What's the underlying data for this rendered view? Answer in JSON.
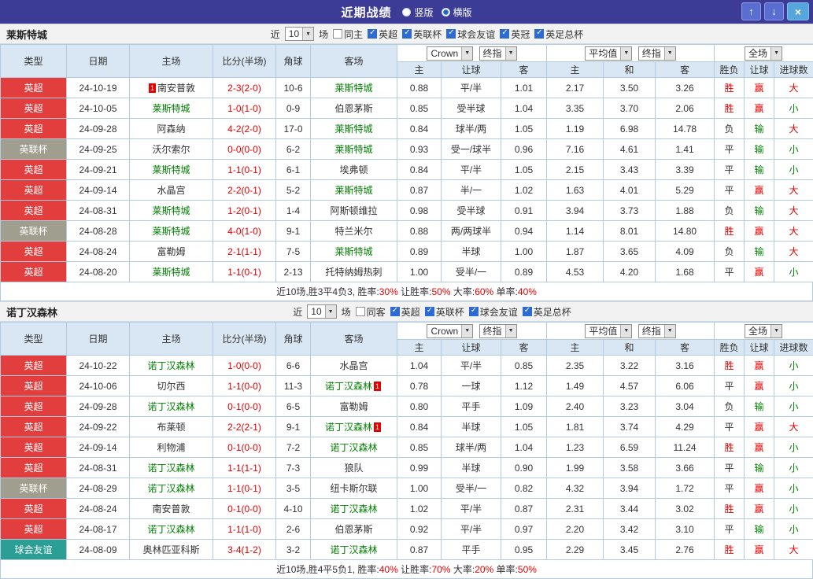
{
  "titlebar": {
    "title": "近期战绩",
    "radios": [
      {
        "label": "竖版",
        "selected": false
      },
      {
        "label": "横版",
        "selected": true
      }
    ],
    "up_icon": "↑",
    "down_icon": "↓",
    "close_icon": "×"
  },
  "filter": {
    "near": "近",
    "count": "10",
    "unit": "场"
  },
  "table_header": {
    "type": "类型",
    "date": "日期",
    "home": "主场",
    "score": "比分(半场)",
    "corner": "角球",
    "away": "客场",
    "bookmaker_select": "Crown",
    "final_select": "终指",
    "avg_select": "平均值",
    "scope_select": "全场",
    "ah_home": "主",
    "ah_line": "让球",
    "ah_away": "客",
    "eu_home": "主",
    "eu_draw": "和",
    "eu_away": "客",
    "result": "胜负",
    "asian": "让球",
    "goals": "进球数"
  },
  "colors": {
    "league": {
      "英超": "#e23e3e",
      "英联杯": "#a09e8e",
      "球会友谊": "#2b9e96"
    },
    "text": {
      "red": "#e60000",
      "green": "#008000",
      "black": "#333333"
    },
    "team_green": "#008000"
  },
  "sections": [
    {
      "team": "莱斯特城",
      "same_label": "同主",
      "same_checked": false,
      "leagues": [
        {
          "label": "英超",
          "checked": true
        },
        {
          "label": "英联杯",
          "checked": true
        },
        {
          "label": "球会友谊",
          "checked": true
        },
        {
          "label": "英冠",
          "checked": true
        },
        {
          "label": "英足总杯",
          "checked": true
        }
      ],
      "rows": [
        {
          "league": "英超",
          "date": "24-10-19",
          "home": {
            "name": "南安普敦",
            "green": false,
            "badge": "1",
            "badge_side": "left"
          },
          "score": "2-3(2-0)",
          "corner": "10-6",
          "away": {
            "name": "莱斯特城",
            "green": true
          },
          "ah": [
            "0.88",
            "平/半",
            "1.01"
          ],
          "eu": [
            "2.17",
            "3.50",
            "3.26"
          ],
          "result": {
            "t": "胜",
            "c": "red"
          },
          "asian": {
            "t": "赢",
            "c": "red"
          },
          "goals": {
            "t": "大",
            "c": "red"
          }
        },
        {
          "league": "英超",
          "date": "24-10-05",
          "home": {
            "name": "莱斯特城",
            "green": true
          },
          "score": "1-0(1-0)",
          "corner": "0-9",
          "away": {
            "name": "伯恩茅斯",
            "green": false
          },
          "ah": [
            "0.85",
            "受半球",
            "1.04"
          ],
          "eu": [
            "3.35",
            "3.70",
            "2.06"
          ],
          "result": {
            "t": "胜",
            "c": "red"
          },
          "asian": {
            "t": "赢",
            "c": "red"
          },
          "goals": {
            "t": "小",
            "c": "green"
          }
        },
        {
          "league": "英超",
          "date": "24-09-28",
          "home": {
            "name": "阿森纳",
            "green": false
          },
          "score": "4-2(2-0)",
          "corner": "17-0",
          "away": {
            "name": "莱斯特城",
            "green": true
          },
          "ah": [
            "0.84",
            "球半/两",
            "1.05"
          ],
          "eu": [
            "1.19",
            "6.98",
            "14.78"
          ],
          "result": {
            "t": "负",
            "c": "black"
          },
          "asian": {
            "t": "输",
            "c": "green"
          },
          "goals": {
            "t": "大",
            "c": "red"
          }
        },
        {
          "league": "英联杯",
          "date": "24-09-25",
          "home": {
            "name": "沃尔索尔",
            "green": false
          },
          "score": "0-0(0-0)",
          "corner": "6-2",
          "away": {
            "name": "莱斯特城",
            "green": true
          },
          "ah": [
            "0.93",
            "受一/球半",
            "0.96"
          ],
          "eu": [
            "7.16",
            "4.61",
            "1.41"
          ],
          "result": {
            "t": "平",
            "c": "black"
          },
          "asian": {
            "t": "输",
            "c": "green"
          },
          "goals": {
            "t": "小",
            "c": "green"
          }
        },
        {
          "league": "英超",
          "date": "24-09-21",
          "home": {
            "name": "莱斯特城",
            "green": true
          },
          "score": "1-1(0-1)",
          "corner": "6-1",
          "away": {
            "name": "埃弗顿",
            "green": false
          },
          "ah": [
            "0.84",
            "平/半",
            "1.05"
          ],
          "eu": [
            "2.15",
            "3.43",
            "3.39"
          ],
          "result": {
            "t": "平",
            "c": "black"
          },
          "asian": {
            "t": "输",
            "c": "green"
          },
          "goals": {
            "t": "小",
            "c": "green"
          }
        },
        {
          "league": "英超",
          "date": "24-09-14",
          "home": {
            "name": "水晶宫",
            "green": false
          },
          "score": "2-2(0-1)",
          "corner": "5-2",
          "away": {
            "name": "莱斯特城",
            "green": true
          },
          "ah": [
            "0.87",
            "半/一",
            "1.02"
          ],
          "eu": [
            "1.63",
            "4.01",
            "5.29"
          ],
          "result": {
            "t": "平",
            "c": "black"
          },
          "asian": {
            "t": "赢",
            "c": "red"
          },
          "goals": {
            "t": "大",
            "c": "red"
          }
        },
        {
          "league": "英超",
          "date": "24-08-31",
          "home": {
            "name": "莱斯特城",
            "green": true
          },
          "score": "1-2(0-1)",
          "corner": "1-4",
          "away": {
            "name": "阿斯顿维拉",
            "green": false
          },
          "ah": [
            "0.98",
            "受半球",
            "0.91"
          ],
          "eu": [
            "3.94",
            "3.73",
            "1.88"
          ],
          "result": {
            "t": "负",
            "c": "black"
          },
          "asian": {
            "t": "输",
            "c": "green"
          },
          "goals": {
            "t": "大",
            "c": "red"
          }
        },
        {
          "league": "英联杯",
          "date": "24-08-28",
          "home": {
            "name": "莱斯特城",
            "green": true
          },
          "score": "4-0(1-0)",
          "corner": "9-1",
          "away": {
            "name": "特兰米尔",
            "green": false
          },
          "ah": [
            "0.88",
            "两/两球半",
            "0.94"
          ],
          "eu": [
            "1.14",
            "8.01",
            "14.80"
          ],
          "result": {
            "t": "胜",
            "c": "red"
          },
          "asian": {
            "t": "赢",
            "c": "red"
          },
          "goals": {
            "t": "大",
            "c": "red"
          }
        },
        {
          "league": "英超",
          "date": "24-08-24",
          "home": {
            "name": "富勒姆",
            "green": false
          },
          "score": "2-1(1-1)",
          "corner": "7-5",
          "away": {
            "name": "莱斯特城",
            "green": true
          },
          "ah": [
            "0.89",
            "半球",
            "1.00"
          ],
          "eu": [
            "1.87",
            "3.65",
            "4.09"
          ],
          "result": {
            "t": "负",
            "c": "black"
          },
          "asian": {
            "t": "输",
            "c": "green"
          },
          "goals": {
            "t": "大",
            "c": "red"
          }
        },
        {
          "league": "英超",
          "date": "24-08-20",
          "home": {
            "name": "莱斯特城",
            "green": true
          },
          "score": "1-1(0-1)",
          "corner": "2-13",
          "away": {
            "name": "托特纳姆热刺",
            "green": false
          },
          "ah": [
            "1.00",
            "受半/一",
            "0.89"
          ],
          "eu": [
            "4.53",
            "4.20",
            "1.68"
          ],
          "result": {
            "t": "平",
            "c": "black"
          },
          "asian": {
            "t": "赢",
            "c": "red"
          },
          "goals": {
            "t": "小",
            "c": "green"
          }
        }
      ],
      "summary": [
        {
          "text": "近10场,胜3平4负3, 胜率:",
          "color": "black"
        },
        {
          "text": "30%",
          "color": "red"
        },
        {
          "text": " 让胜率:",
          "color": "black"
        },
        {
          "text": "50%",
          "color": "red"
        },
        {
          "text": " 大率:",
          "color": "black"
        },
        {
          "text": "60%",
          "color": "red"
        },
        {
          "text": " 单率:",
          "color": "black"
        },
        {
          "text": "40%",
          "color": "red"
        }
      ]
    },
    {
      "team": "诺丁汉森林",
      "same_label": "同客",
      "same_checked": false,
      "leagues": [
        {
          "label": "英超",
          "checked": true
        },
        {
          "label": "英联杯",
          "checked": true
        },
        {
          "label": "球会友谊",
          "checked": true
        },
        {
          "label": "英足总杯",
          "checked": true
        }
      ],
      "rows": [
        {
          "league": "英超",
          "date": "24-10-22",
          "home": {
            "name": "诺丁汉森林",
            "green": true
          },
          "score": "1-0(0-0)",
          "corner": "6-6",
          "away": {
            "name": "水晶宫",
            "green": false
          },
          "ah": [
            "1.04",
            "平/半",
            "0.85"
          ],
          "eu": [
            "2.35",
            "3.22",
            "3.16"
          ],
          "result": {
            "t": "胜",
            "c": "red"
          },
          "asian": {
            "t": "赢",
            "c": "red"
          },
          "goals": {
            "t": "小",
            "c": "green"
          }
        },
        {
          "league": "英超",
          "date": "24-10-06",
          "home": {
            "name": "切尔西",
            "green": false
          },
          "score": "1-1(0-0)",
          "corner": "11-3",
          "away": {
            "name": "诺丁汉森林",
            "green": true,
            "badge": "1",
            "badge_side": "right"
          },
          "ah": [
            "0.78",
            "一球",
            "1.12"
          ],
          "eu": [
            "1.49",
            "4.57",
            "6.06"
          ],
          "result": {
            "t": "平",
            "c": "black"
          },
          "asian": {
            "t": "赢",
            "c": "red"
          },
          "goals": {
            "t": "小",
            "c": "green"
          }
        },
        {
          "league": "英超",
          "date": "24-09-28",
          "home": {
            "name": "诺丁汉森林",
            "green": true
          },
          "score": "0-1(0-0)",
          "corner": "6-5",
          "away": {
            "name": "富勒姆",
            "green": false
          },
          "ah": [
            "0.80",
            "平手",
            "1.09"
          ],
          "eu": [
            "2.40",
            "3.23",
            "3.04"
          ],
          "result": {
            "t": "负",
            "c": "black"
          },
          "asian": {
            "t": "输",
            "c": "green"
          },
          "goals": {
            "t": "小",
            "c": "green"
          }
        },
        {
          "league": "英超",
          "date": "24-09-22",
          "home": {
            "name": "布莱顿",
            "green": false
          },
          "score": "2-2(2-1)",
          "corner": "9-1",
          "away": {
            "name": "诺丁汉森林",
            "green": true,
            "badge": "1",
            "badge_side": "right"
          },
          "ah": [
            "0.84",
            "半球",
            "1.05"
          ],
          "eu": [
            "1.81",
            "3.74",
            "4.29"
          ],
          "result": {
            "t": "平",
            "c": "black"
          },
          "asian": {
            "t": "赢",
            "c": "red"
          },
          "goals": {
            "t": "大",
            "c": "red"
          }
        },
        {
          "league": "英超",
          "date": "24-09-14",
          "home": {
            "name": "利物浦",
            "green": false
          },
          "score": "0-1(0-0)",
          "corner": "7-2",
          "away": {
            "name": "诺丁汉森林",
            "green": true
          },
          "ah": [
            "0.85",
            "球半/两",
            "1.04"
          ],
          "eu": [
            "1.23",
            "6.59",
            "11.24"
          ],
          "result": {
            "t": "胜",
            "c": "red"
          },
          "asian": {
            "t": "赢",
            "c": "red"
          },
          "goals": {
            "t": "小",
            "c": "green"
          }
        },
        {
          "league": "英超",
          "date": "24-08-31",
          "home": {
            "name": "诺丁汉森林",
            "green": true
          },
          "score": "1-1(1-1)",
          "corner": "7-3",
          "away": {
            "name": "狼队",
            "green": false
          },
          "ah": [
            "0.99",
            "半球",
            "0.90"
          ],
          "eu": [
            "1.99",
            "3.58",
            "3.66"
          ],
          "result": {
            "t": "平",
            "c": "black"
          },
          "asian": {
            "t": "输",
            "c": "green"
          },
          "goals": {
            "t": "小",
            "c": "green"
          }
        },
        {
          "league": "英联杯",
          "date": "24-08-29",
          "home": {
            "name": "诺丁汉森林",
            "green": true
          },
          "score": "1-1(0-1)",
          "corner": "3-5",
          "away": {
            "name": "纽卡斯尔联",
            "green": false
          },
          "ah": [
            "1.00",
            "受半/一",
            "0.82"
          ],
          "eu": [
            "4.32",
            "3.94",
            "1.72"
          ],
          "result": {
            "t": "平",
            "c": "black"
          },
          "asian": {
            "t": "赢",
            "c": "red"
          },
          "goals": {
            "t": "小",
            "c": "green"
          }
        },
        {
          "league": "英超",
          "date": "24-08-24",
          "home": {
            "name": "南安普敦",
            "green": false
          },
          "score": "0-1(0-0)",
          "corner": "4-10",
          "away": {
            "name": "诺丁汉森林",
            "green": true
          },
          "ah": [
            "1.02",
            "平/半",
            "0.87"
          ],
          "eu": [
            "2.31",
            "3.44",
            "3.02"
          ],
          "result": {
            "t": "胜",
            "c": "red"
          },
          "asian": {
            "t": "赢",
            "c": "red"
          },
          "goals": {
            "t": "小",
            "c": "green"
          }
        },
        {
          "league": "英超",
          "date": "24-08-17",
          "home": {
            "name": "诺丁汉森林",
            "green": true
          },
          "score": "1-1(1-0)",
          "corner": "2-6",
          "away": {
            "name": "伯恩茅斯",
            "green": false
          },
          "ah": [
            "0.92",
            "平/半",
            "0.97"
          ],
          "eu": [
            "2.20",
            "3.42",
            "3.10"
          ],
          "result": {
            "t": "平",
            "c": "black"
          },
          "asian": {
            "t": "输",
            "c": "green"
          },
          "goals": {
            "t": "小",
            "c": "green"
          }
        },
        {
          "league": "球会友谊",
          "date": "24-08-09",
          "home": {
            "name": "奥林匹亚科斯",
            "green": false
          },
          "score": "3-4(1-2)",
          "corner": "3-2",
          "away": {
            "name": "诺丁汉森林",
            "green": true
          },
          "ah": [
            "0.87",
            "平手",
            "0.95"
          ],
          "eu": [
            "2.29",
            "3.45",
            "2.76"
          ],
          "result": {
            "t": "胜",
            "c": "red"
          },
          "asian": {
            "t": "赢",
            "c": "red"
          },
          "goals": {
            "t": "大",
            "c": "red"
          }
        }
      ],
      "summary": [
        {
          "text": "近10场,胜4平5负1, 胜率:",
          "color": "black"
        },
        {
          "text": "40%",
          "color": "red"
        },
        {
          "text": " 让胜率:",
          "color": "black"
        },
        {
          "text": "70%",
          "color": "red"
        },
        {
          "text": " 大率:",
          "color": "black"
        },
        {
          "text": "20%",
          "color": "red"
        },
        {
          "text": " 单率:",
          "color": "black"
        },
        {
          "text": "50%",
          "color": "red"
        }
      ]
    }
  ]
}
